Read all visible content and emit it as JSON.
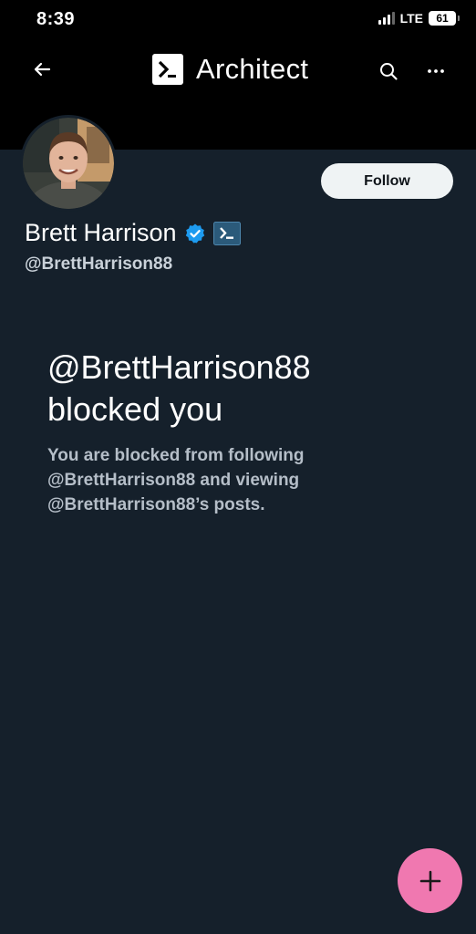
{
  "status_bar": {
    "time": "8:39",
    "network": "LTE",
    "battery": "61"
  },
  "nav": {
    "brand_name": "Architect",
    "icons": [
      "back-arrow-icon",
      "search-icon",
      "more-icon"
    ]
  },
  "profile": {
    "display_name": "Brett Harrison",
    "handle": "@BrettHarrison88",
    "follow_label": "Follow",
    "badges": [
      "verified-icon",
      "affiliate-badge-icon"
    ]
  },
  "blocked": {
    "title_line1": "@BrettHarrison88",
    "title_line2": "blocked you",
    "desc_line1": "You are blocked from following",
    "desc_line2": "@BrettHarrison88 and viewing",
    "desc_line3": "@BrettHarrison88’s posts."
  },
  "fab": {
    "icon": "plus-icon"
  },
  "colors": {
    "background": "#15202b",
    "header": "#000000",
    "fab": "#f078b0",
    "verified": "#1d9bf0",
    "affiliate_badge": "#2b5a7a"
  }
}
